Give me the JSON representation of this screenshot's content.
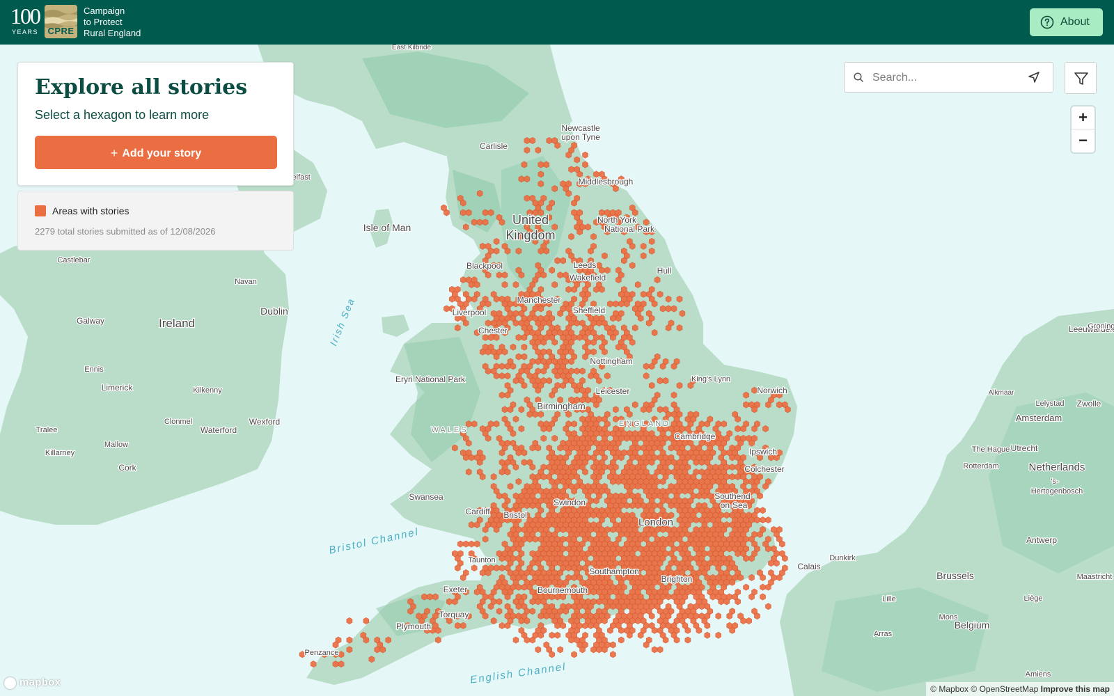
{
  "brand": {
    "years_number": "100",
    "years_label": "YEARS",
    "badge_text": "CPRE",
    "org_name_lines": [
      "Campaign",
      "to Protect",
      "Rural England"
    ]
  },
  "header": {
    "about_label": "About",
    "about_icon": "question-circle-icon"
  },
  "panel": {
    "title": "Explore all stories",
    "subtitle": "Select a hexagon to learn more",
    "add_button_icon": "+",
    "add_button_label": "Add your story"
  },
  "legend": {
    "label": "Areas with stories",
    "swatch_color": "#eb6e42",
    "count_text": "2279 total stories submitted as of 12/08/2026"
  },
  "search": {
    "placeholder": "Search...",
    "search_icon": "search-icon",
    "locate_icon": "location-arrow-icon"
  },
  "filter": {
    "icon": "filter-icon"
  },
  "zoom": {
    "in_label": "+",
    "out_label": "−"
  },
  "map": {
    "attribution_mapbox": "© Mapbox",
    "attribution_osm": "© OpenStreetMap",
    "attribution_improve": "Improve this map",
    "logo_text": "mapbox",
    "colors": {
      "sea": "#e6f7f8",
      "land": "#b9ddc9",
      "land_dark": "#96cdb1",
      "hex": "#eb6e42"
    },
    "place_labels": [
      "East Kilbride",
      "Carlisle",
      "Newcastle",
      "upon Tyne",
      "Middlesbrough",
      "North York",
      "National Park",
      "United",
      "Kingdom",
      "Isle of Man",
      "Blackpool",
      "Leeds",
      "Wakefield",
      "Hull",
      "Liverpool",
      "Manchester",
      "Sheffield",
      "Chester",
      "Nottingham",
      "Eryri National Park",
      "King's Lynn",
      "Norwich",
      "Leicester",
      "Birmingham",
      "ENGLAND",
      "WALES",
      "Cambridge",
      "Ipswich",
      "Colchester",
      "Swansea",
      "Swindon",
      "Southend-",
      "on-Sea",
      "Cardiff",
      "Bristol",
      "London",
      "Taunton",
      "Southampton",
      "Brighton",
      "Exeter",
      "Bournemouth",
      "Torquay",
      "Plymouth",
      "Penzance",
      "Castlebar",
      "Navan",
      "Dublin",
      "Galway",
      "Ireland",
      "Ennis",
      "Limerick",
      "Kilkenny",
      "Clonmel",
      "Wexford",
      "Tralee",
      "Mallow",
      "Waterford",
      "Killarney",
      "Cork",
      "Belfast",
      "Leeuwarden",
      "Alkmaar",
      "Lelystad",
      "Zwolle",
      "Amsterdam",
      "The Hague",
      "Utrecht",
      "Rotterdam",
      "Netherlands",
      "'s-",
      "Hertogenbosch",
      "Antwerp",
      "Dunkirk",
      "Calais",
      "Brussels",
      "Maastricht",
      "Lille",
      "Liège",
      "Mons",
      "Belgium",
      "Arras",
      "Amiens",
      "Groningen"
    ],
    "sea_labels": [
      "Irish Sea",
      "Bristol Channel",
      "English Channel"
    ]
  }
}
